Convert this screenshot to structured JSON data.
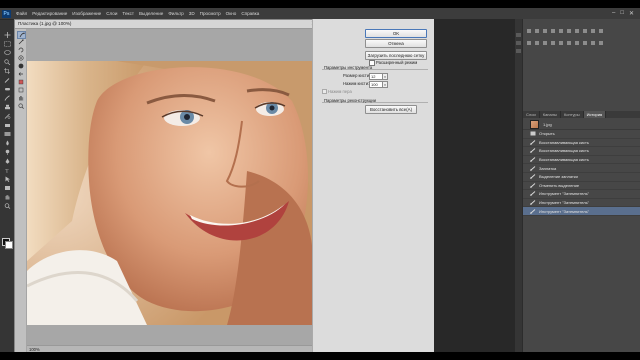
{
  "menubar": {
    "logo": "Ps",
    "items": [
      "Файл",
      "Редактирование",
      "Изображение",
      "Слои",
      "Текст",
      "Выделение",
      "Фильтр",
      "3D",
      "Просмотр",
      "Окно",
      "Справка"
    ],
    "window_controls": [
      "–",
      "□",
      "✕"
    ]
  },
  "dialog": {
    "title": "Пластика (1.jpg @ 100%)",
    "close": "✕",
    "buttons": {
      "ok": "OK",
      "cancel": "Отмена",
      "load_last_mesh": "Загрузить последнюю сетку",
      "restore_all": "Восстановить все(А)"
    },
    "advanced_mode": "Расширенный режим",
    "tool_options": {
      "heading": "Параметры инструмента",
      "brush_size_label": "Размер кисти:",
      "brush_size_value": "12",
      "brush_pressure_label": "Нажим кисти:",
      "brush_pressure_value": "100",
      "stylus_pressure": "Нажим пера"
    },
    "reconstruct": {
      "heading": "Параметры реконструкции"
    },
    "zoom": "100%"
  },
  "panel": {
    "tabs": [
      "Слои",
      "Каналы",
      "Контуры",
      "История"
    ],
    "active_tab": "История",
    "snapshot": "1.jpg",
    "history_items": [
      "Открыть",
      "Восстанавливающая кисть",
      "Восстанавливающая кисть",
      "Восстанавливающая кисть",
      "Заплатка",
      "Выделение заплатки",
      "Отменить выделение",
      "Инструмент \"Затемнитель\"",
      "Инструмент \"Затемнитель\"",
      "Инструмент \"Затемнитель\""
    ],
    "selected_index": 9
  },
  "colors": {
    "dialog_bg": "#c8c8c8",
    "panel_bg": "#474747",
    "selected_row": "#5a6f8e",
    "ok_border": "#4a78b8"
  }
}
